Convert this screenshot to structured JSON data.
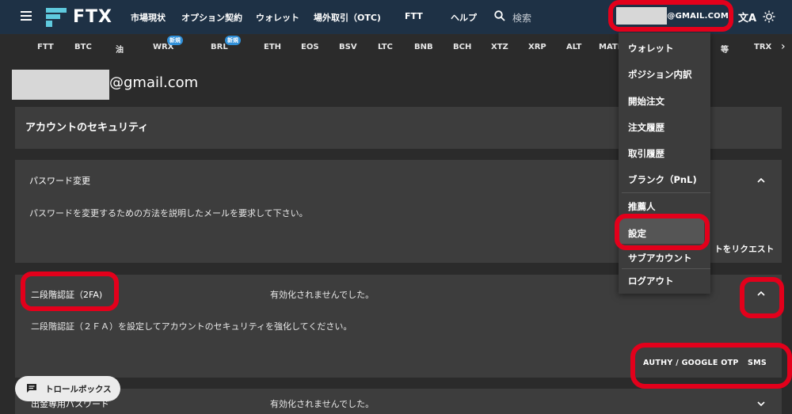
{
  "topbar": {
    "logo": "FTX",
    "nav": [
      "市場現状",
      "オプション契約",
      "ウォレット",
      "場外取引（OTC)",
      "FTT",
      "ヘルプ"
    ],
    "search_placeholder": "検索",
    "account_email": "@GMAIL.COM"
  },
  "ticker": {
    "items": [
      "FTT",
      "BTC",
      "油",
      "WRX",
      "BRL",
      "ETH",
      "EOS",
      "BSV",
      "LTC",
      "BNB",
      "BCH",
      "XTZ",
      "XRP",
      "ALT",
      "MATI",
      "等",
      "TRX"
    ],
    "new_badge": "新規"
  },
  "account": {
    "email_suffix": "@gmail.com"
  },
  "security": {
    "title": "アカウントのセキュリティ",
    "password": {
      "label": "パスワード変更",
      "description": "パスワードを変更するための方法を説明したメールを要求して下さい。",
      "request_button": "トをリクエスト"
    },
    "twofa": {
      "label": "二段階認証（2FA)",
      "status": "有効化されませんでした。",
      "description": "二段階認証（２ＦＡ）を設定してアカウントのセキュリティを強化してください。",
      "button_authy": "AUTHY / GOOGLE OTP",
      "button_sms": "SMS"
    },
    "withdraw": {
      "label": "出金専用パスワード",
      "status": "有効化されませんでした。"
    }
  },
  "menu": {
    "items": [
      "ウォレット",
      "ポジション内訳",
      "開始注文",
      "注文履歴",
      "取引履歴",
      "ブランク（PnL)",
      "推薦人",
      "設定",
      "サブアカウント",
      "ログアウト"
    ]
  },
  "trollbox": {
    "label": "トロールボックス"
  },
  "colors": {
    "topbar": "#1e3145",
    "accent": "#5fcade",
    "annotation": "#e3001b",
    "card": "#3d3d3d"
  }
}
